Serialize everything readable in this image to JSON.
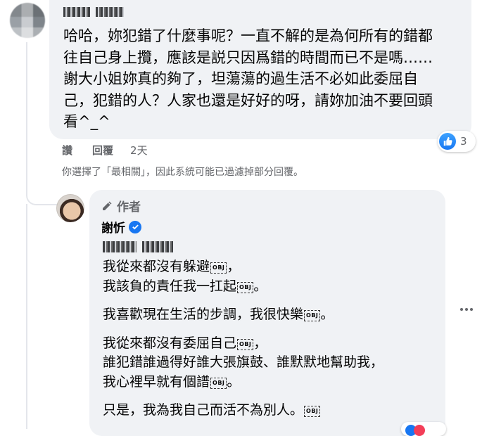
{
  "comment": {
    "lines": [
      "哈哈，妳犯錯了什麼事呢？一直不解的是為何所有的錯都",
      "往自己身上攬，應該是説只因爲錯的時間而已不是嗎……",
      "謝大小姐妳真的夠了，坦蕩蕩的過生活不必如此委屈自",
      "己，犯錯的人？人家也還是好好的呀，請妳加油不要回頭",
      "看^_^"
    ],
    "reaction_count": "3",
    "like_label": "讚",
    "reply_label": "回覆",
    "time": "2天"
  },
  "filter_note": "你選擇了「最相關」，因此系統可能已過濾掉部分回覆。",
  "reply": {
    "author_badge": "作者",
    "author_name": "謝忻",
    "paragraphs": [
      [
        "我從來都沒有躲避",
        "我該負的責任我一扛起"
      ],
      [
        "我喜歡現在生活的步調，我很快樂"
      ],
      [
        "我從來都沒有委屈自己",
        "誰犯錯誰過得好誰大張旗鼓、誰默默地幫助我，",
        "我心裡早就有個譜"
      ],
      [
        "只是，我為我自己而活不為別人。"
      ]
    ],
    "line_suffixes": [
      [
        "，",
        "。"
      ],
      [
        "。"
      ],
      [
        "，",
        "",
        "。"
      ],
      [
        ""
      ]
    ],
    "obj_label": "OBJ"
  },
  "colors": {
    "bubble": "#f0f2f5",
    "secondary_text": "#65676b",
    "facebook_blue": "#1877f2"
  }
}
